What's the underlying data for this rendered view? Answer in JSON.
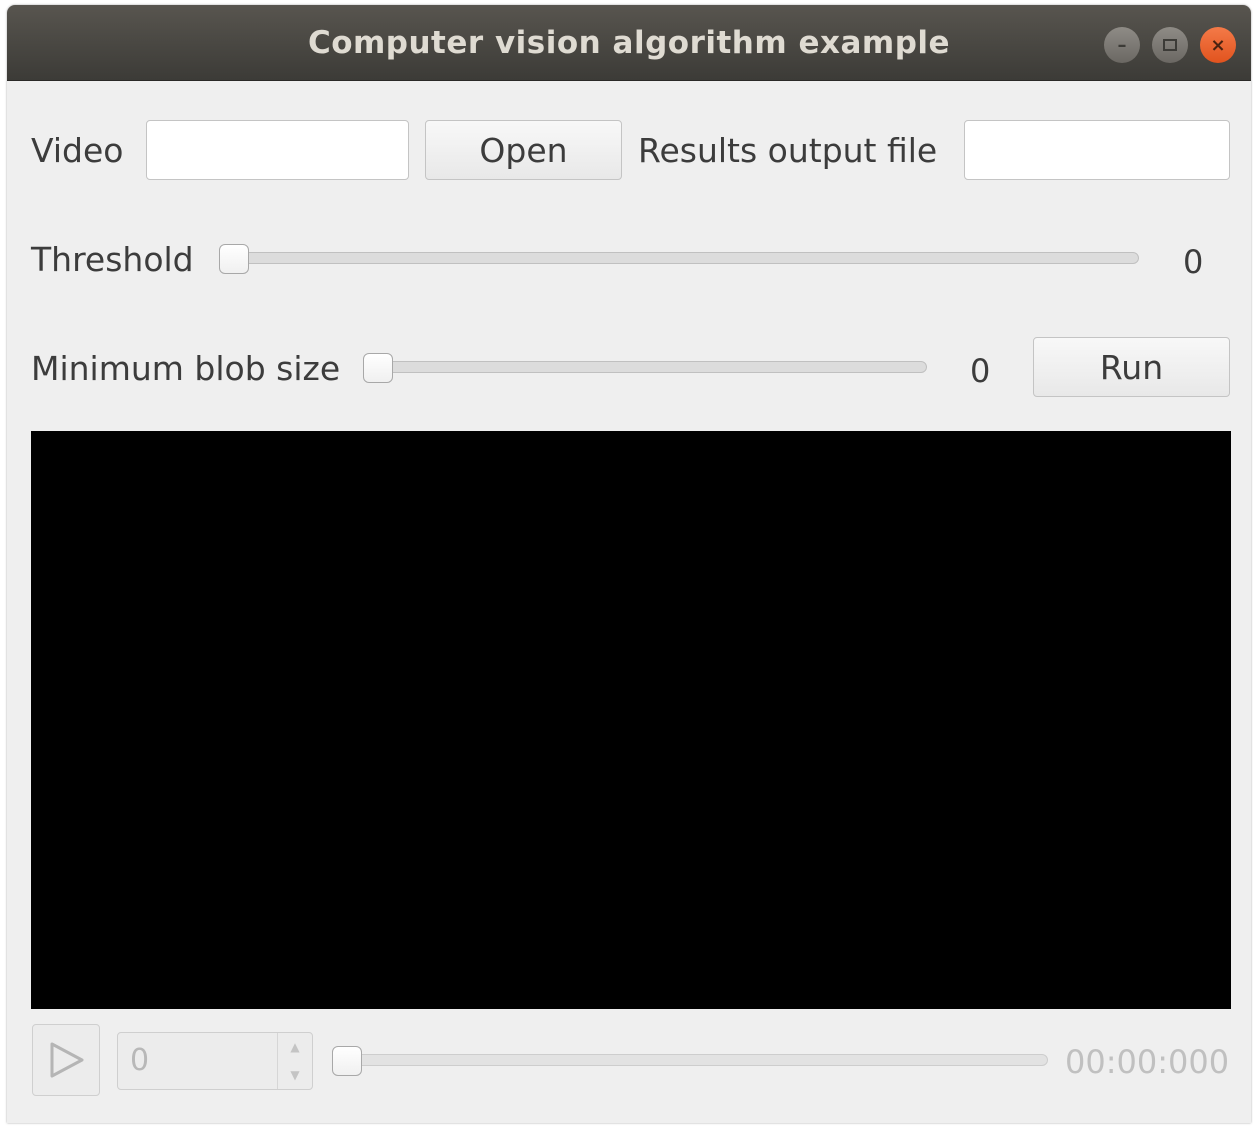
{
  "window": {
    "title": "Computer vision algorithm example",
    "controls": {
      "minimize_icon": "minimize-icon",
      "maximize_icon": "maximize-icon",
      "close_icon": "close-icon"
    }
  },
  "form": {
    "video_label": "Video",
    "video_value": "",
    "open_button": "Open",
    "results_label": "Results output file",
    "results_value": "",
    "threshold_label": "Threshold",
    "threshold_value": "0",
    "min_blob_label": "Minimum blob size",
    "min_blob_value": "0",
    "run_button": "Run"
  },
  "player": {
    "play_icon": "play-icon",
    "frame_value": "0",
    "position_value": 0,
    "time": "00:00:000"
  },
  "colors": {
    "titlebar": "#3c3b37",
    "close_button": "#e95420",
    "background": "#efefef",
    "video_area": "#000000"
  }
}
